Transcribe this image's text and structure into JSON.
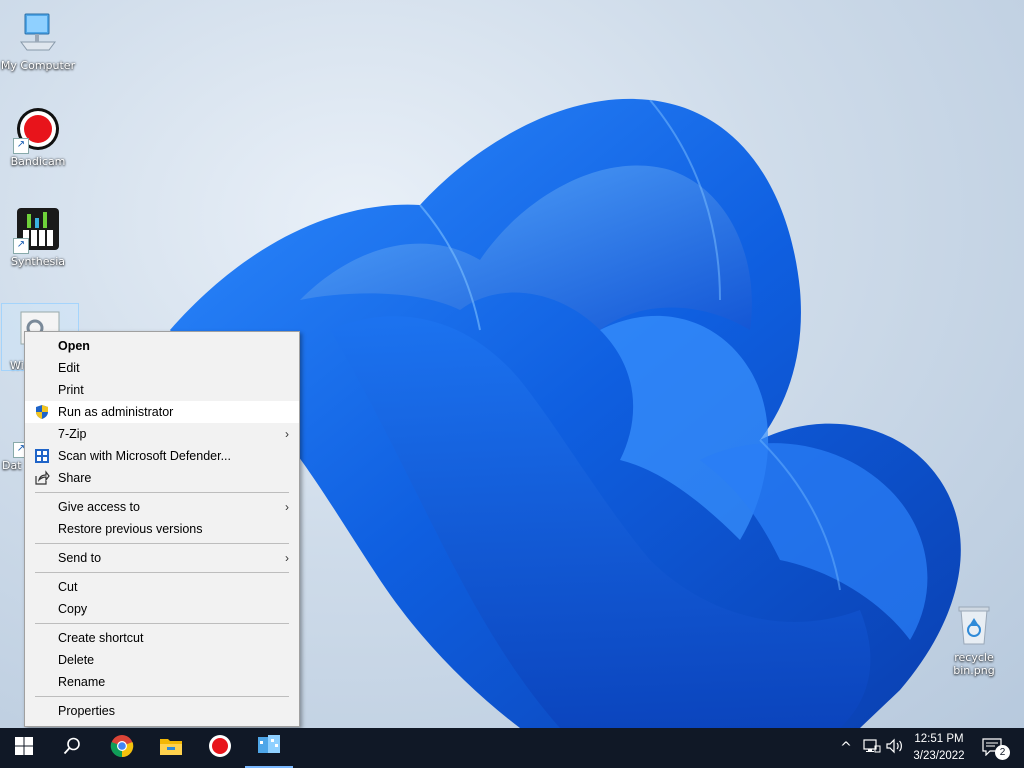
{
  "desktop": {
    "icons": [
      {
        "label": "My Computer",
        "name": "my-computer"
      },
      {
        "label": "Bandicam",
        "name": "bandicam"
      },
      {
        "label": "Synthesia",
        "name": "synthesia"
      },
      {
        "label": "Wi",
        "name": "selected-file"
      },
      {
        "label": "Dat",
        "name": "data-app"
      },
      {
        "label": "recycle bin.png",
        "name": "recycle-bin-png"
      }
    ]
  },
  "context_menu": {
    "items": {
      "open": "Open",
      "edit": "Edit",
      "print": "Print",
      "run_as_admin": "Run as administrator",
      "seven_zip": "7-Zip",
      "scan_defender": "Scan with Microsoft Defender...",
      "share": "Share",
      "give_access": "Give access to",
      "restore_versions": "Restore previous versions",
      "send_to": "Send to",
      "cut": "Cut",
      "copy": "Copy",
      "create_shortcut": "Create shortcut",
      "delete": "Delete",
      "rename": "Rename",
      "properties": "Properties"
    },
    "submenu_glyph": "›",
    "highlighted": "run_as_admin"
  },
  "taskbar": {
    "apps": [
      {
        "icon": "windows-start-icon"
      },
      {
        "icon": "search-icon"
      },
      {
        "icon": "chrome-icon"
      },
      {
        "icon": "file-explorer-icon"
      },
      {
        "icon": "bandicam-icon"
      },
      {
        "icon": "app-window-icon"
      }
    ],
    "tray": {
      "chevron": "^",
      "time": "12:51 PM",
      "date": "3/23/2022",
      "notification_count": "2"
    }
  },
  "colors": {
    "taskbar": "#101826",
    "menu_bg": "#f2f2f2",
    "menu_highlight": "#ffffff",
    "wallpaper_blue": "#1a6fe0"
  }
}
